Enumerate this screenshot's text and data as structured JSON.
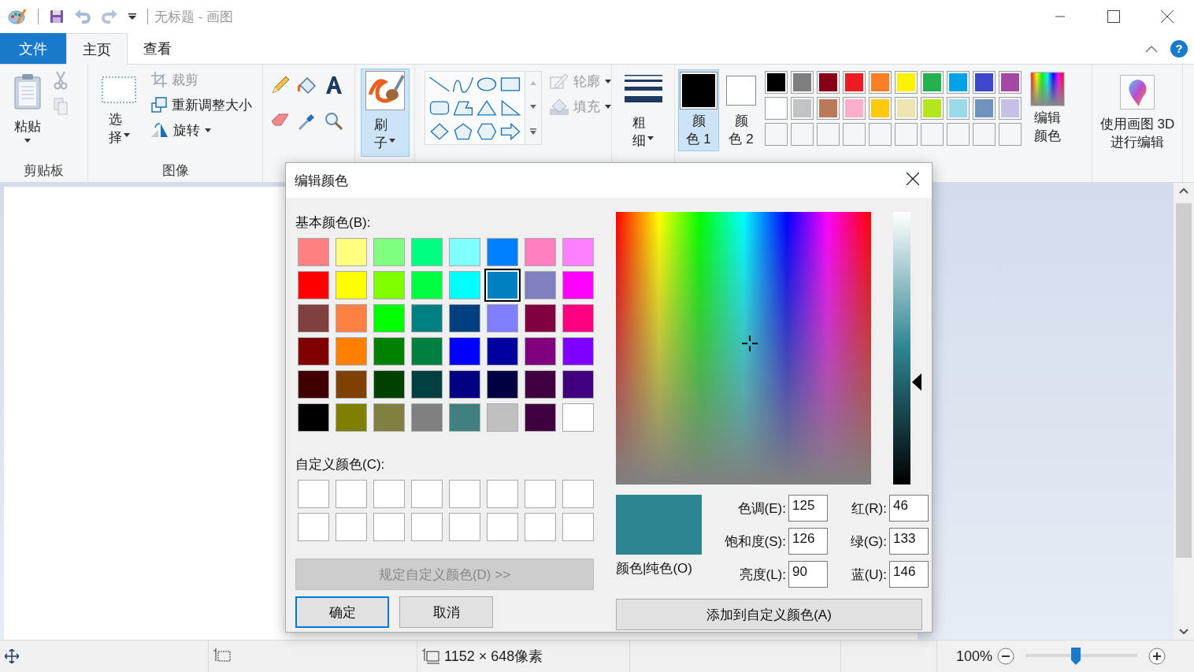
{
  "window": {
    "title": "无标题 - 画图"
  },
  "tabs": [
    {
      "label": "文件",
      "kind": "file",
      "selected": false
    },
    {
      "label": "主页",
      "kind": "tab",
      "selected": true
    },
    {
      "label": "查看",
      "kind": "tab",
      "selected": false
    }
  ],
  "help": {
    "label": "?"
  },
  "ribbon": {
    "clipboard": {
      "label": "剪贴板",
      "paste": "粘贴"
    },
    "image": {
      "label": "图像",
      "select": "选择",
      "crop": {
        "label": "裁剪",
        "disabled": true
      },
      "resize": {
        "label": "重新调整大小",
        "disabled": false
      },
      "rotate": {
        "label": "旋转",
        "disabled": false
      }
    },
    "brushes": {
      "label": "刷子",
      "selected": true
    },
    "shapes": {
      "outline": {
        "label": "轮廓",
        "disabled": true
      },
      "fill": {
        "label": "填充",
        "disabled": true
      }
    },
    "size": {
      "label": "粗细"
    },
    "colors": {
      "color1": {
        "label": "颜色 1",
        "selected": true
      },
      "color2": {
        "label": "颜色 2",
        "selected": false
      },
      "palette": [
        {
          "kind": "color",
          "color": "#000000"
        },
        {
          "kind": "color",
          "color": "#7f7f7f"
        },
        {
          "kind": "color",
          "color": "#880015"
        },
        {
          "kind": "color",
          "color": "#ed1c24"
        },
        {
          "kind": "color",
          "color": "#ff7f27"
        },
        {
          "kind": "color",
          "color": "#fff200"
        },
        {
          "kind": "color",
          "color": "#22b14c"
        },
        {
          "kind": "color",
          "color": "#00a2e8"
        },
        {
          "kind": "color",
          "color": "#3f48cc"
        },
        {
          "kind": "color",
          "color": "#a349a4"
        },
        {
          "kind": "color",
          "color": "#ffffff"
        },
        {
          "kind": "color",
          "color": "#c3c3c3"
        },
        {
          "kind": "color",
          "color": "#b97a57"
        },
        {
          "kind": "color",
          "color": "#ffaec9"
        },
        {
          "kind": "color",
          "color": "#ffc90e"
        },
        {
          "kind": "color",
          "color": "#efe4b0"
        },
        {
          "kind": "color",
          "color": "#b5e61d"
        },
        {
          "kind": "color",
          "color": "#99d9ea"
        },
        {
          "kind": "color",
          "color": "#7092be"
        },
        {
          "kind": "color",
          "color": "#c8bfe7"
        },
        {
          "kind": "empty"
        },
        {
          "kind": "empty"
        },
        {
          "kind": "empty"
        },
        {
          "kind": "empty"
        },
        {
          "kind": "empty"
        },
        {
          "kind": "empty"
        },
        {
          "kind": "empty"
        },
        {
          "kind": "empty"
        },
        {
          "kind": "empty"
        },
        {
          "kind": "empty"
        }
      ],
      "edit": "编辑颜色"
    },
    "paint3d": {
      "label": "使用画图 3D 进行编辑"
    }
  },
  "dialog": {
    "title": "编辑颜色",
    "basic_label": "基本颜色(B):",
    "basic_colors": [
      {
        "color": "#ff8080",
        "selected": false
      },
      {
        "color": "#ffff80",
        "selected": false
      },
      {
        "color": "#80ff80",
        "selected": false
      },
      {
        "color": "#00ff80",
        "selected": false
      },
      {
        "color": "#80ffff",
        "selected": false
      },
      {
        "color": "#0080ff",
        "selected": false
      },
      {
        "color": "#ff80c0",
        "selected": false
      },
      {
        "color": "#ff80ff",
        "selected": false
      },
      {
        "color": "#ff0000",
        "selected": false
      },
      {
        "color": "#ffff00",
        "selected": false
      },
      {
        "color": "#80ff00",
        "selected": false
      },
      {
        "color": "#00ff40",
        "selected": false
      },
      {
        "color": "#00ffff",
        "selected": false
      },
      {
        "color": "#0080c0",
        "selected": true
      },
      {
        "color": "#8080c0",
        "selected": false
      },
      {
        "color": "#ff00ff",
        "selected": false
      },
      {
        "color": "#804040",
        "selected": false
      },
      {
        "color": "#ff8040",
        "selected": false
      },
      {
        "color": "#00ff00",
        "selected": false
      },
      {
        "color": "#008080",
        "selected": false
      },
      {
        "color": "#004080",
        "selected": false
      },
      {
        "color": "#8080ff",
        "selected": false
      },
      {
        "color": "#800040",
        "selected": false
      },
      {
        "color": "#ff0080",
        "selected": false
      },
      {
        "color": "#800000",
        "selected": false
      },
      {
        "color": "#ff8000",
        "selected": false
      },
      {
        "color": "#008000",
        "selected": false
      },
      {
        "color": "#008040",
        "selected": false
      },
      {
        "color": "#0000ff",
        "selected": false
      },
      {
        "color": "#0000a0",
        "selected": false
      },
      {
        "color": "#800080",
        "selected": false
      },
      {
        "color": "#8000ff",
        "selected": false
      },
      {
        "color": "#400000",
        "selected": false
      },
      {
        "color": "#804000",
        "selected": false
      },
      {
        "color": "#004000",
        "selected": false
      },
      {
        "color": "#004040",
        "selected": false
      },
      {
        "color": "#000080",
        "selected": false
      },
      {
        "color": "#000040",
        "selected": false
      },
      {
        "color": "#400040",
        "selected": false
      },
      {
        "color": "#400080",
        "selected": false
      },
      {
        "color": "#000000",
        "selected": false
      },
      {
        "color": "#808000",
        "selected": false
      },
      {
        "color": "#808040",
        "selected": false
      },
      {
        "color": "#808080",
        "selected": false
      },
      {
        "color": "#408080",
        "selected": false
      },
      {
        "color": "#c0c0c0",
        "selected": false
      },
      {
        "color": "#400040",
        "selected": false
      },
      {
        "color": "#ffffff",
        "selected": false
      }
    ],
    "custom_label": "自定义颜色(C):",
    "custom_colors": [
      {
        "kind": "empty"
      },
      {
        "kind": "empty"
      },
      {
        "kind": "empty"
      },
      {
        "kind": "empty"
      },
      {
        "kind": "empty"
      },
      {
        "kind": "empty"
      },
      {
        "kind": "empty"
      },
      {
        "kind": "empty"
      },
      {
        "kind": "empty"
      },
      {
        "kind": "empty"
      },
      {
        "kind": "empty"
      },
      {
        "kind": "empty"
      },
      {
        "kind": "empty"
      },
      {
        "kind": "empty"
      },
      {
        "kind": "empty"
      },
      {
        "kind": "empty"
      }
    ],
    "define_button": {
      "label": "规定自定义颜色(D) >>",
      "disabled": true
    },
    "ok": "确定",
    "cancel": "取消",
    "luminance": {
      "level": 0.376
    },
    "preview": {
      "color": "#2e8592"
    },
    "preview_label": "颜色|纯色(O)",
    "fields": [
      {
        "label": "色调(E):",
        "value": "125"
      },
      {
        "label": "红(R):",
        "value": "46"
      },
      {
        "label": "饱和度(S):",
        "value": "126"
      },
      {
        "label": "绿(G):",
        "value": "133"
      },
      {
        "label": "亮度(L):",
        "value": "90"
      },
      {
        "label": "蓝(U):",
        "value": "146"
      }
    ],
    "add_button": "添加到自定义颜色(A)"
  },
  "status_bar": {
    "size": "1152 × 648像素",
    "zoom": "100%",
    "zoom_slider": {
      "level": 0.45
    }
  }
}
